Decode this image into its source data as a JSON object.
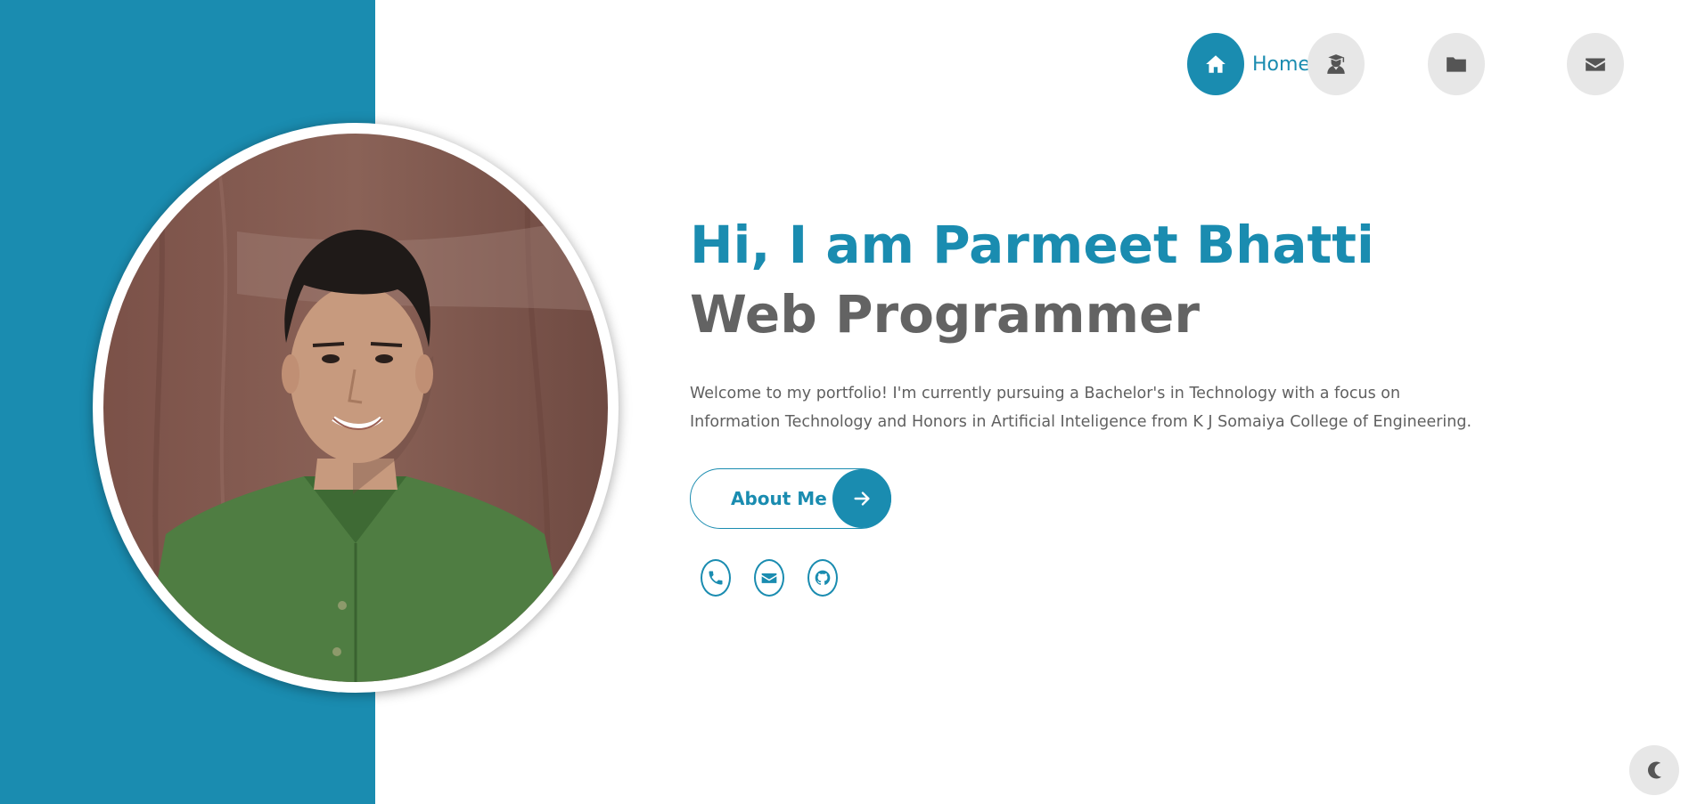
{
  "nav": {
    "items": [
      {
        "label": "Home",
        "icon": "home-icon",
        "active": true
      },
      {
        "icon": "graduate-icon",
        "active": false
      },
      {
        "icon": "folder-icon",
        "active": false
      },
      {
        "icon": "envelope-icon",
        "active": false
      }
    ]
  },
  "hero": {
    "greeting": "Hi, I am Parmeet Bhatti",
    "role": "Web Programmer",
    "intro": "Welcome to my portfolio! I'm currently pursuing a Bachelor's in Technology with a focus on Information Technology and Honors in Artificial Inteligence from K J Somaiya College of Engineering.",
    "about_button": "About Me"
  },
  "socials": [
    {
      "icon": "phone-icon"
    },
    {
      "icon": "envelope-icon"
    },
    {
      "icon": "github-icon"
    }
  ],
  "theme_toggle": {
    "icon": "moon-icon"
  },
  "colors": {
    "accent": "#1a8cb0",
    "heading_gray": "#636363",
    "text_gray": "#606060",
    "nav_inactive": "#e7e7e7"
  }
}
